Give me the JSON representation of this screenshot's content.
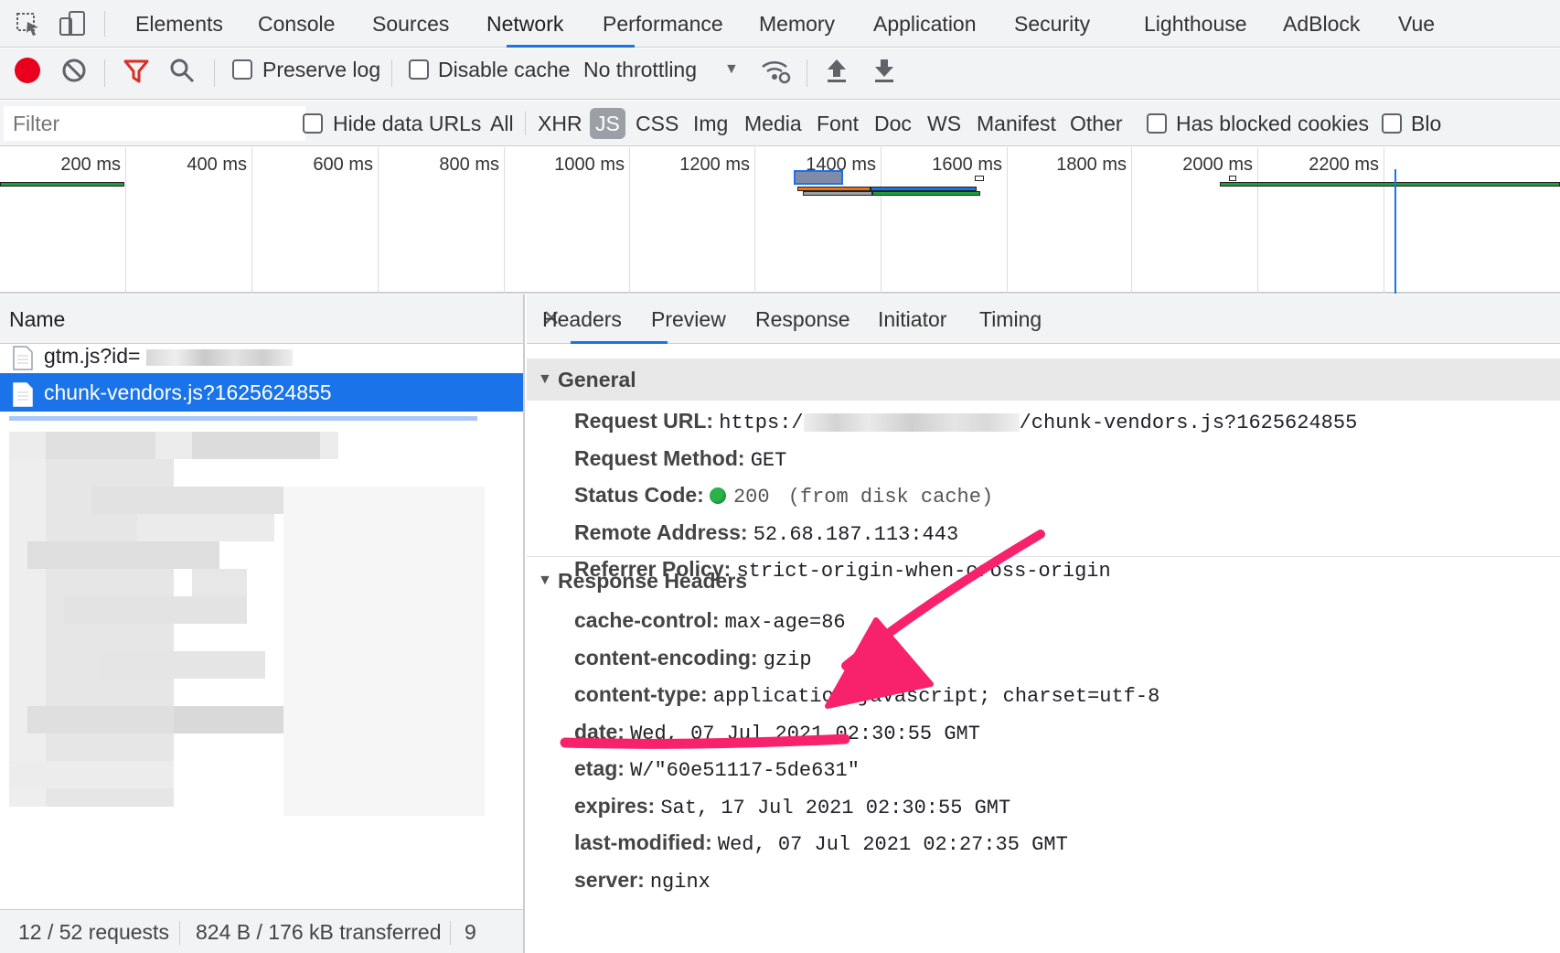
{
  "tabs": [
    "Elements",
    "Console",
    "Sources",
    "Network",
    "Performance",
    "Memory",
    "Application",
    "Security",
    "Lighthouse",
    "AdBlock",
    "Vue"
  ],
  "active_tab": "Network",
  "toolbar": {
    "preserve_log": "Preserve log",
    "disable_cache": "Disable cache",
    "throttling": "No throttling"
  },
  "filter": {
    "placeholder": "Filter",
    "hide_data_urls": "Hide data URLs",
    "types": [
      "All",
      "XHR",
      "JS",
      "CSS",
      "Img",
      "Media",
      "Font",
      "Doc",
      "WS",
      "Manifest",
      "Other"
    ],
    "active_type": "JS",
    "has_blocked_cookies": "Has blocked cookies",
    "blocked_truncated": "Blo"
  },
  "overview": {
    "ticks": [
      "200 ms",
      "400 ms",
      "600 ms",
      "800 ms",
      "1000 ms",
      "1200 ms",
      "1400 ms",
      "1600 ms",
      "1800 ms",
      "2000 ms",
      "2200 ms"
    ]
  },
  "name_column": "Name",
  "requests": [
    {
      "name": "gtm.js?id="
    },
    {
      "name": "chunk-vendors.js?1625624855",
      "selected": true
    }
  ],
  "status": {
    "requests": "12 / 52 requests",
    "transferred": "824 B / 176 kB transferred",
    "extra": "9"
  },
  "detail_tabs": [
    "Headers",
    "Preview",
    "Response",
    "Initiator",
    "Timing"
  ],
  "active_detail_tab": "Headers",
  "general": {
    "title": "General",
    "request_url_key": "Request URL:",
    "request_url_prefix": "https:/",
    "request_url_suffix": "/chunk-vendors.js?1625624855",
    "request_method_key": "Request Method:",
    "request_method": "GET",
    "status_code_key": "Status Code:",
    "status_code": "200",
    "status_note": "(from disk cache)",
    "remote_address_key": "Remote Address:",
    "remote_address": "52.68.187.113:443",
    "referrer_policy_key": "Referrer Policy:",
    "referrer_policy": "strict-origin-when-cross-origin"
  },
  "response_headers": {
    "title": "Response Headers",
    "items": [
      {
        "key": "cache-control:",
        "value": "max-age=86"
      },
      {
        "key": "content-encoding:",
        "value": "gzip"
      },
      {
        "key": "content-type:",
        "value": "application/javascript; charset=utf-8"
      },
      {
        "key": "date:",
        "value": "Wed, 07 Jul 2021 02:30:55 GMT"
      },
      {
        "key": "etag:",
        "value": "W/\"60e51117-5de631\""
      },
      {
        "key": "expires:",
        "value": "Sat, 17 Jul 2021 02:30:55 GMT"
      },
      {
        "key": "last-modified:",
        "value": "Wed, 07 Jul 2021 02:27:35 GMT"
      },
      {
        "key": "server:",
        "value": "nginx"
      }
    ]
  },
  "colors": {
    "accent": "#1a73e8",
    "record": "#e8001c",
    "filter_icon": "#d93025",
    "status_ok": "#2ab34a",
    "annotation": "#f7216c"
  }
}
